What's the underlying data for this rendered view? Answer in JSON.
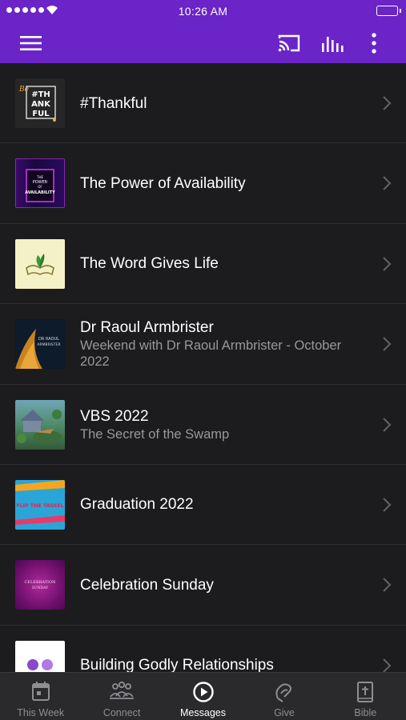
{
  "status_bar": {
    "time": "10:26 AM"
  },
  "app_bar": {
    "menu_icon": "hamburger-icon",
    "actions": [
      "cast-icon",
      "equalizer-icon",
      "more-vertical-icon"
    ]
  },
  "messages": [
    {
      "title": "#Thankful",
      "subtitle": "",
      "thumb_text": [
        "#TH",
        "ANK",
        "FUL"
      ]
    },
    {
      "title": "The Power of Availability",
      "subtitle": "",
      "thumb_text": [
        "THE",
        "POWER",
        "OF",
        "AVAILABILITY"
      ]
    },
    {
      "title": "The Word Gives Life",
      "subtitle": ""
    },
    {
      "title": "Dr Raoul Armbrister",
      "subtitle": "Weekend with Dr Raoul Armbrister - October 2022",
      "thumb_text": [
        "DR RAOUL",
        "ARMBRISTER"
      ]
    },
    {
      "title": "VBS 2022",
      "subtitle": "The Secret of the Swamp"
    },
    {
      "title": "Graduation 2022",
      "subtitle": "",
      "thumb_text": "FLIP THE TASSEL"
    },
    {
      "title": "Celebration Sunday",
      "subtitle": "",
      "thumb_text": [
        "CELEBRATION",
        "SUNDAY"
      ]
    },
    {
      "title": "Building Godly Relationships",
      "subtitle": ""
    }
  ],
  "tabs": [
    {
      "label": "This Week",
      "icon": "calendar-icon"
    },
    {
      "label": "Connect",
      "icon": "people-icon"
    },
    {
      "label": "Messages",
      "icon": "play-circle-icon",
      "active": true
    },
    {
      "label": "Give",
      "icon": "give-icon"
    },
    {
      "label": "Bible",
      "icon": "bible-icon"
    }
  ],
  "colors": {
    "accent": "#6a24c8",
    "background": "#1c1c1e",
    "tab_bar": "#2a2a2c"
  }
}
